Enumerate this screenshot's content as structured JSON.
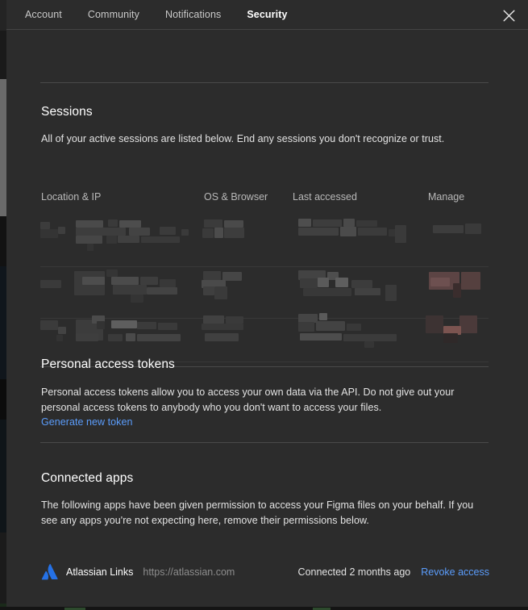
{
  "window": {
    "close_icon": "close-icon"
  },
  "tabs": [
    {
      "label": "Account",
      "active": false
    },
    {
      "label": "Community",
      "active": false
    },
    {
      "label": "Notifications",
      "active": false
    },
    {
      "label": "Security",
      "active": true
    }
  ],
  "sessions": {
    "title": "Sessions",
    "description": "All of your active sessions are listed below. End any sessions you don't recognize or trust.",
    "columns": [
      "Location & IP",
      "OS & Browser",
      "Last accessed",
      "Manage"
    ],
    "rows": [
      {
        "location_ip": "",
        "os_browser": "",
        "last_accessed": "",
        "manage": "",
        "redacted": true
      },
      {
        "location_ip": "",
        "os_browser": "",
        "last_accessed": "",
        "manage": "",
        "redacted": true
      },
      {
        "location_ip": "",
        "os_browser": "",
        "last_accessed": "",
        "manage": "",
        "redacted": true
      }
    ]
  },
  "tokens": {
    "title": "Personal access tokens",
    "description": "Personal access tokens allow you to access your own data via the API. Do not give out your personal access tokens to anybody who you don't want to access your files.",
    "generate_link": "Generate new token"
  },
  "connected_apps": {
    "title": "Connected apps",
    "description": "The following apps have been given permission to access your Figma files on your behalf. If you see any apps you're not expecting here, remove their permissions below.",
    "apps": [
      {
        "icon": "atlassian-logo-icon",
        "name": "Atlassian Links",
        "url": "https://atlassian.com",
        "connected": "Connected 2 months ago",
        "revoke_label": "Revoke access"
      }
    ]
  },
  "colors": {
    "modal_bg": "#2c2c2c",
    "text_primary": "#ffffff",
    "text_secondary": "#e3e3e3",
    "text_muted": "#8d8d8d",
    "link_blue": "#5b9dfc",
    "danger_red": "#8a4a4a",
    "divider": "#4a4a4a",
    "atlassian_blue": "#2571e6"
  }
}
